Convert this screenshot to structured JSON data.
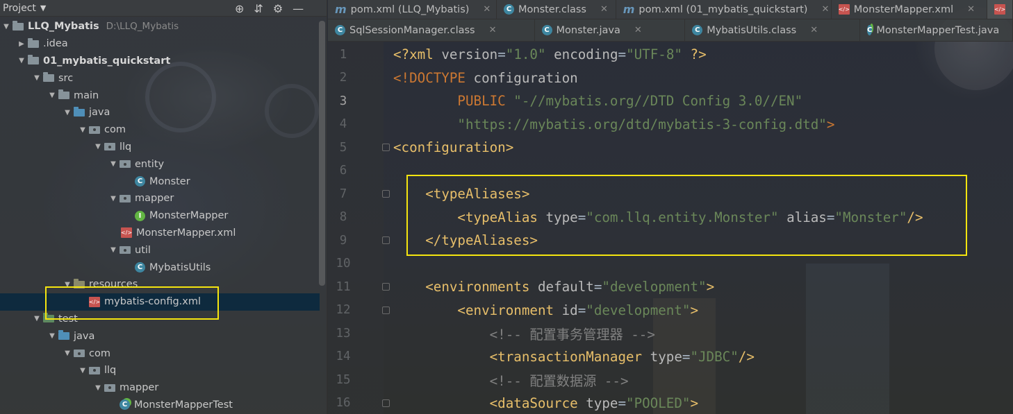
{
  "project_panel": {
    "title": "Project",
    "tree": [
      {
        "depth": 0,
        "arrow": "▼",
        "icon": "folder",
        "label": "LLQ_Mybatis",
        "bold": true,
        "path": "D:\\LLQ_Mybatis"
      },
      {
        "depth": 1,
        "arrow": "▶",
        "icon": "folder",
        "label": ".idea"
      },
      {
        "depth": 1,
        "arrow": "▼",
        "icon": "folder",
        "label": "01_mybatis_quickstart",
        "bold": true
      },
      {
        "depth": 2,
        "arrow": "▼",
        "icon": "folder",
        "label": "src"
      },
      {
        "depth": 3,
        "arrow": "▼",
        "icon": "folder",
        "label": "main"
      },
      {
        "depth": 4,
        "arrow": "▼",
        "icon": "folder-java",
        "label": "java"
      },
      {
        "depth": 5,
        "arrow": "▼",
        "icon": "package",
        "label": "com"
      },
      {
        "depth": 6,
        "arrow": "▼",
        "icon": "package",
        "label": "llq"
      },
      {
        "depth": 7,
        "arrow": "▼",
        "icon": "package",
        "label": "entity"
      },
      {
        "depth": 8,
        "arrow": "",
        "icon": "class",
        "label": "Monster"
      },
      {
        "depth": 7,
        "arrow": "▼",
        "icon": "package",
        "label": "mapper"
      },
      {
        "depth": 8,
        "arrow": "",
        "icon": "interface",
        "label": "MonsterMapper"
      },
      {
        "depth": 8,
        "arrow": "",
        "icon": "xml",
        "label": "MonsterMapper.xml",
        "shift": -1
      },
      {
        "depth": 7,
        "arrow": "▼",
        "icon": "package",
        "label": "util"
      },
      {
        "depth": 8,
        "arrow": "",
        "icon": "class",
        "label": "MybatisUtils"
      },
      {
        "depth": 4,
        "arrow": "▼",
        "icon": "folder-res",
        "label": "resources"
      },
      {
        "depth": 5,
        "arrow": "",
        "icon": "xml",
        "label": "mybatis-config.xml",
        "selected": true
      },
      {
        "depth": 2,
        "arrow": "▼",
        "icon": "folder-test",
        "label": "test"
      },
      {
        "depth": 3,
        "arrow": "▼",
        "icon": "folder-java",
        "label": "java"
      },
      {
        "depth": 4,
        "arrow": "▼",
        "icon": "package",
        "label": "com"
      },
      {
        "depth": 5,
        "arrow": "▼",
        "icon": "package",
        "label": "llq"
      },
      {
        "depth": 6,
        "arrow": "▼",
        "icon": "package",
        "label": "mapper"
      },
      {
        "depth": 7,
        "arrow": "",
        "icon": "test-class",
        "label": "MonsterMapperTest"
      }
    ]
  },
  "tabs_row1": [
    {
      "icon": "maven-icon",
      "label": "pom.xml (LLQ_Mybatis)"
    },
    {
      "icon": "class-icon",
      "label": "Monster.class"
    },
    {
      "icon": "maven-icon",
      "label": "pom.xml (01_mybatis_quickstart)"
    },
    {
      "icon": "xml-icon",
      "label": "MonsterMapper.xml"
    }
  ],
  "tabs_row2": [
    {
      "icon": "class-icon",
      "label": "SqlSessionManager.class"
    },
    {
      "icon": "class-icon",
      "label": "Monster.java"
    },
    {
      "icon": "class-icon",
      "label": "MybatisUtils.class"
    },
    {
      "icon": "test-class-icon",
      "label": "MonsterMapperTest.java"
    }
  ],
  "editor": {
    "current_line": 3,
    "lines": [
      {
        "n": "1",
        "html": "<span class='t-punc'>&lt;?</span><span class='t-tag'>xml </span><span class='t-attr'>version</span>=<span class='t-val'>\"1.0\"</span> <span class='t-attr'>encoding</span>=<span class='t-val'>\"UTF-8\"</span> <span class='t-punc'>?&gt;</span>"
      },
      {
        "n": "2",
        "html": "<span class='t-kw'>&lt;!DOCTYPE </span><span class='t-attr'>configuration</span>"
      },
      {
        "n": "3",
        "html": "        <span class='t-kw'>PUBLIC </span><span class='t-str'>\"-//mybatis.org//DTD Config 3.0//EN\"</span>"
      },
      {
        "n": "4",
        "html": "        <span class='t-str'>\"https://mybatis.org/dtd/mybatis-3-config.dtd\"</span><span class='t-kw'>&gt;</span>"
      },
      {
        "n": "5",
        "html": "<span class='t-tag'>&lt;configuration&gt;</span>",
        "fold": true
      },
      {
        "n": "6",
        "html": ""
      },
      {
        "n": "7",
        "html": "    <span class='t-tag'>&lt;typeAliases&gt;</span>",
        "fold": true
      },
      {
        "n": "8",
        "html": "        <span class='t-tag'>&lt;typeAlias </span><span class='t-attr'>type</span>=<span class='t-val'>\"com.llq.entity.Monster\"</span> <span class='t-attr'>alias</span>=<span class='t-val'>\"Monster\"</span><span class='t-tag'>/&gt;</span>"
      },
      {
        "n": "9",
        "html": "    <span class='t-tag'>&lt;/typeAliases&gt;</span>",
        "fold": true
      },
      {
        "n": "10",
        "html": ""
      },
      {
        "n": "11",
        "html": "    <span class='t-tag'>&lt;environments </span><span class='t-attr'>default</span>=<span class='t-val'>\"development\"</span><span class='t-tag'>&gt;</span>",
        "fold": true
      },
      {
        "n": "12",
        "html": "        <span class='t-tag'>&lt;environment </span><span class='t-attr'>id</span>=<span class='t-val'>\"development\"</span><span class='t-tag'>&gt;</span>",
        "fold": true
      },
      {
        "n": "13",
        "html": "            <span class='t-com'>&lt;!-- 配置事务管理器 --&gt;</span>"
      },
      {
        "n": "14",
        "html": "            <span class='t-tag'>&lt;transactionManager </span><span class='t-attr'>type</span>=<span class='t-val'>\"JDBC\"</span><span class='t-tag'>/&gt;</span>"
      },
      {
        "n": "15",
        "html": "            <span class='t-com'>&lt;!-- 配置数据源 --&gt;</span>"
      },
      {
        "n": "16",
        "html": "            <span class='t-tag'>&lt;dataSource </span><span class='t-attr'>type</span>=<span class='t-val'>\"POOLED\"</span><span class='t-tag'>&gt;</span>",
        "fold": true
      }
    ]
  },
  "colors": {
    "highlight": "#f5e50f",
    "selection": "#0d293e",
    "tag": "#e8bf6a",
    "string": "#6a8759",
    "keyword": "#cc7832"
  }
}
